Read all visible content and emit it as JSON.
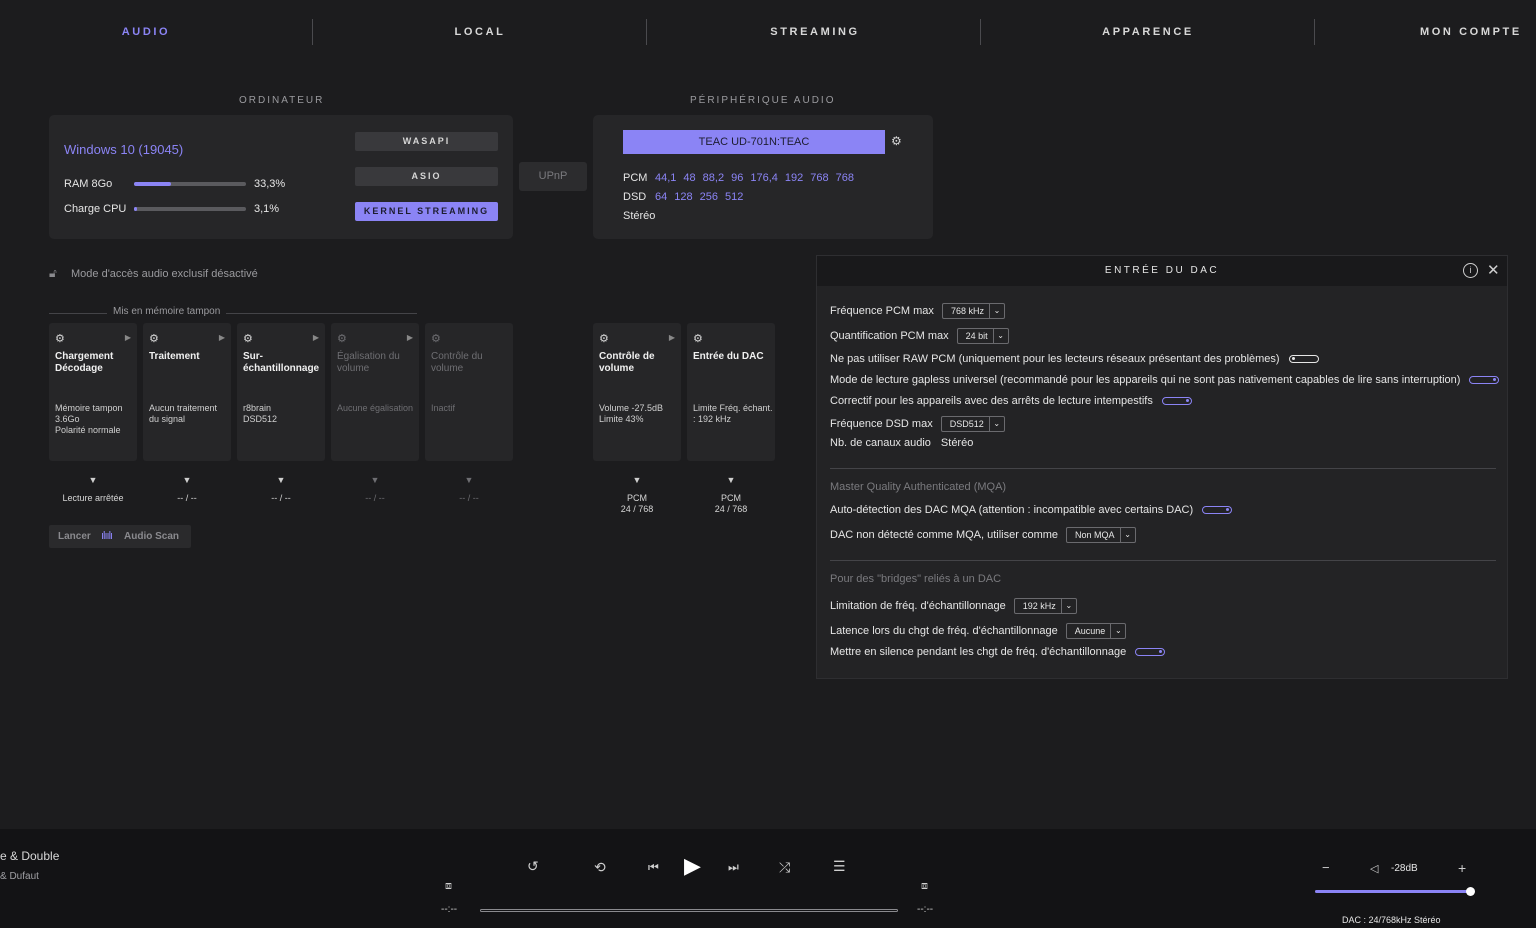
{
  "nav": {
    "tabs": [
      "AUDIO",
      "LOCAL",
      "STREAMING",
      "APPARENCE",
      "MON COMPTE"
    ],
    "active": 0
  },
  "computer": {
    "section_title": "ORDINATEUR",
    "os": "Windows 10 (19045)",
    "ram_label": "RAM 8Go",
    "ram_value": "33,3%",
    "ram_fraction": 0.333,
    "cpu_label": "Charge CPU",
    "cpu_value": "3,1%",
    "cpu_fraction": 0.031,
    "modes": [
      "WASAPI",
      "ASIO",
      "KERNEL STREAMING"
    ],
    "upnp": "UPnP"
  },
  "device": {
    "section_title": "PÉRIPHÉRIQUE AUDIO",
    "name": "TEAC UD-701N:TEAC",
    "pcm_label": "PCM",
    "pcm_rates": [
      "44,1",
      "48",
      "88,2",
      "96",
      "176,4",
      "192",
      "768",
      "768"
    ],
    "dsd_label": "DSD",
    "dsd_rates": [
      "64",
      "128",
      "256",
      "512"
    ],
    "channels": "Stéréo"
  },
  "exclusive_mode": "Mode d'accès audio exclusif désactivé",
  "buffer_label": "Mis en mémoire tampon",
  "chain": [
    {
      "title": "Chargement Décodage",
      "desc": "Mémoire tampon 3.6Go\nPolarité normale",
      "status": "Lecture arrêtée",
      "dim": false,
      "arrow": true
    },
    {
      "title": "Traitement",
      "desc": "Aucun traitement du signal",
      "status": "-- / --",
      "dim": false,
      "arrow": true
    },
    {
      "title": "Sur-échantillonnage",
      "desc": "r8brain\nDSD512",
      "status": "-- / --",
      "dim": false,
      "arrow": true
    },
    {
      "title": "Égalisation du volume",
      "desc": "Aucune égalisation",
      "status": "-- / --",
      "dim": true,
      "arrow": true
    },
    {
      "title": "Contrôle du volume",
      "desc": "Inactif",
      "status": "-- / --",
      "dim": true,
      "arrow": false
    },
    {
      "title": "Contrôle de volume",
      "desc": "Volume -27.5dB\nLimite 43%",
      "status": "PCM\n24 / 768",
      "dim": false,
      "arrow": true
    },
    {
      "title": "Entrée du DAC",
      "desc": "Limite Fréq. échant. : 192 kHz",
      "status": "PCM\n24 / 768",
      "dim": false,
      "arrow": false
    }
  ],
  "audio_scan": {
    "prefix": "Lancer",
    "label": "Audio Scan"
  },
  "dac_panel": {
    "title": "ENTRÉE DU DAC",
    "pcm_max_label": "Fréquence PCM max",
    "pcm_max_value": "768 kHz",
    "quant_label": "Quantification PCM max",
    "quant_value": "24 bit",
    "raw_pcm_label": "Ne pas utiliser RAW PCM (uniquement pour les lecteurs réseaux présentant des problèmes)",
    "gapless_label": "Mode de lecture gapless universel (recommandé pour les appareils qui ne sont pas nativement capables de lire sans interruption)",
    "fix_label": "Correctif pour les appareils avec des arrêts de lecture intempestifs",
    "dsd_max_label": "Fréquence DSD max",
    "dsd_max_value": "DSD512",
    "channels_label": "Nb. de canaux audio",
    "channels_value": "Stéréo",
    "mqa_heading": "Master Quality Authenticated (MQA)",
    "mqa_auto_label": "Auto-détection des DAC MQA (attention : incompatible avec certains DAC)",
    "mqa_fallback_label": "DAC non détecté comme MQA, utiliser comme",
    "mqa_fallback_value": "Non MQA",
    "bridges_heading": "Pour des \"bridges\" reliés à un DAC",
    "limit_label": "Limitation de fréq. d'échantillonnage",
    "limit_value": "192 kHz",
    "latency_label": "Latence lors du chgt de fréq. d'échantillonnage",
    "latency_value": "Aucune",
    "silence_label": "Mettre en silence pendant les chgt de fréq. d'échantillonnage"
  },
  "player": {
    "track_title": "e & Double",
    "track_artist": "& Dufaut",
    "time_elapsed": "--:--",
    "time_total": "--:--",
    "volume_text": "-28dB",
    "volume_fraction": 0.99,
    "dac_status": "DAC : 24/768kHz Stéréo",
    "minus": "−",
    "plus": "+"
  }
}
